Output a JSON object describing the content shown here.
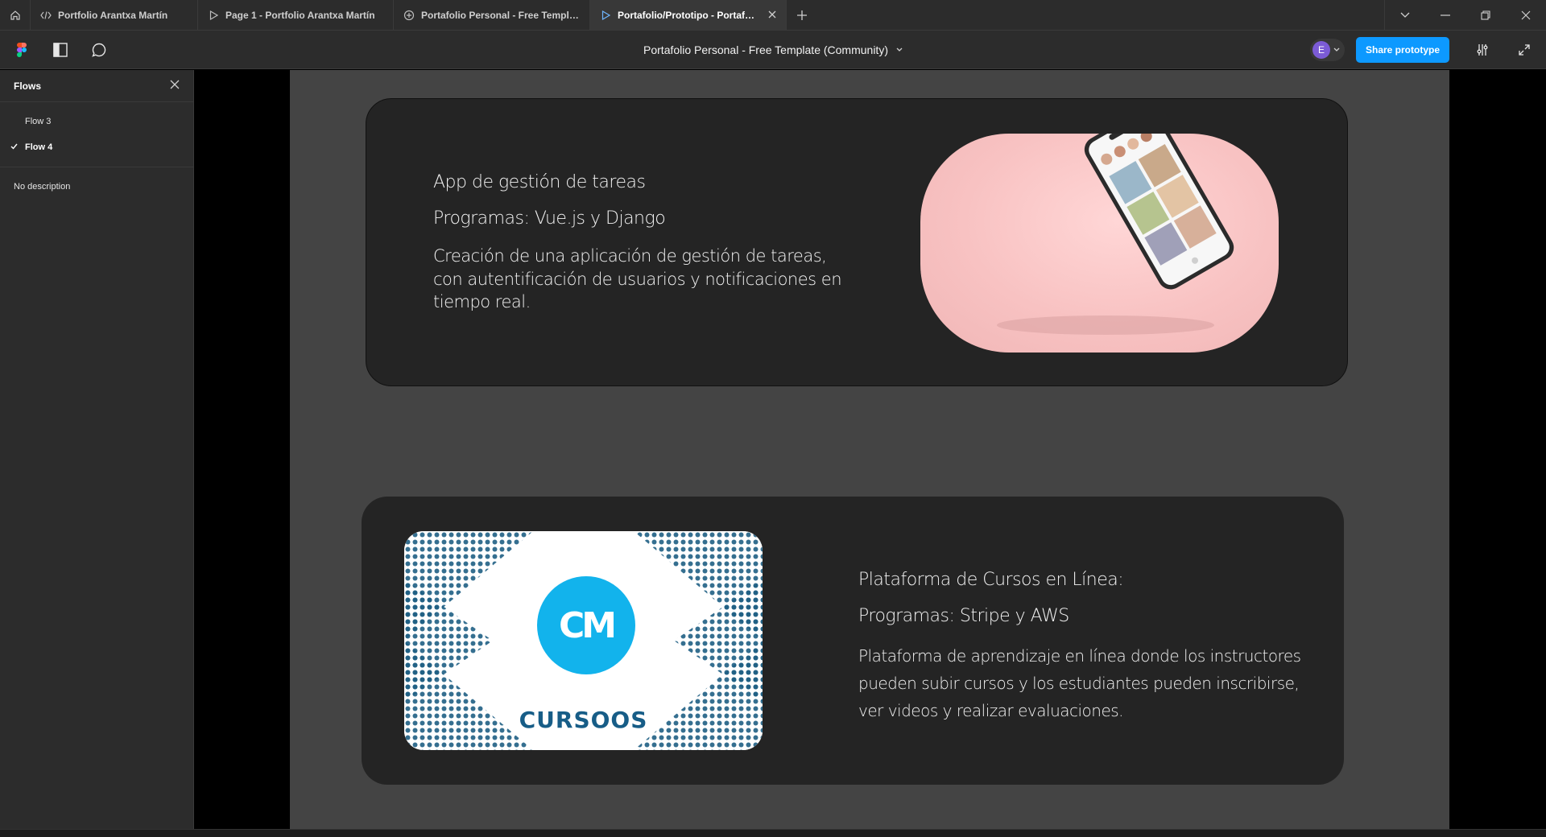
{
  "tabs": [
    {
      "label": "Portfolio Arantxa Martín",
      "icon": "code-icon"
    },
    {
      "label": "Page 1 - Portfolio Arantxa Martín",
      "icon": "play-icon"
    },
    {
      "label": "Portafolio Personal - Free Template (C",
      "icon": "community-icon"
    },
    {
      "label": "Portafolio/Prototipo - Portafolio P",
      "icon": "play-icon",
      "active": true
    }
  ],
  "toolbar": {
    "document_title": "Portafolio Personal - Free Template (Community)",
    "avatar_initial": "E",
    "share_label": "Share prototype"
  },
  "sidebar": {
    "title": "Flows",
    "flows": [
      {
        "label": "Flow 3",
        "selected": false
      },
      {
        "label": "Flow 4",
        "selected": true
      }
    ],
    "description": "No description"
  },
  "cards": [
    {
      "title": "App de gestión de tareas",
      "programs": "Programas: Vue.js y Django",
      "description": "Creación de una aplicación de gestión de tareas, con autentificación de usuarios y notificaciones en tiempo real."
    },
    {
      "title": "Plataforma de Cursos en Línea:",
      "programs": "Programas: Stripe y AWS",
      "description": "Plataforma de aprendizaje en línea donde los instructores pueden subir cursos y los estudiantes pueden inscribirse, ver videos y realizar evaluaciones."
    }
  ],
  "logo": {
    "monogram": "CM",
    "wordmark": "CURSOOS"
  },
  "colors": {
    "accent": "#0d99ff",
    "chrome": "#2c2c2c",
    "frame_bg": "#444444",
    "card_bg": "#242424",
    "logo_blue": "#12b3ec",
    "logo_text": "#175d87"
  }
}
